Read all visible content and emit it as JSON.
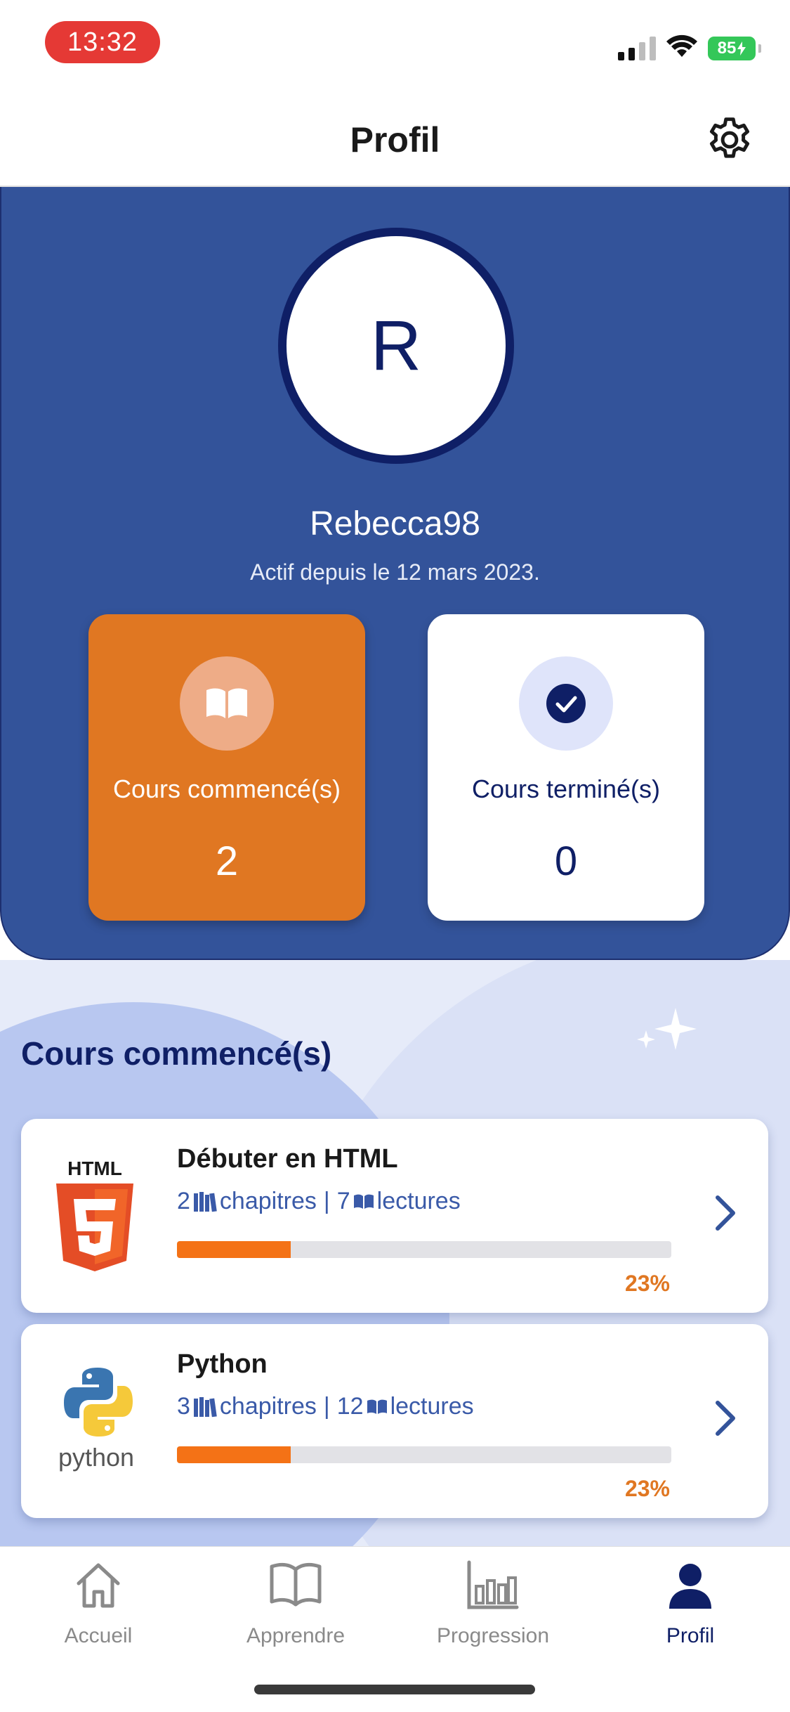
{
  "status_bar": {
    "time": "13:32",
    "battery": "85"
  },
  "header": {
    "title": "Profil"
  },
  "profile": {
    "avatar_initial": "R",
    "username": "Rebecca98",
    "active_since": "Actif depuis le 12 mars 2023."
  },
  "stats": {
    "started": {
      "label": "Cours commencé(s)",
      "value": "2"
    },
    "finished": {
      "label": "Cours terminé(s)",
      "value": "0"
    }
  },
  "courses_section": {
    "title": "Cours commencé(s)",
    "courses": [
      {
        "name": "Débuter en HTML",
        "chapters": "2",
        "chapters_label": "chapitres",
        "separator": "|",
        "lectures": "7",
        "lectures_label": "lectures",
        "progress": 23,
        "progress_label": "23%",
        "logo": "html5-logo",
        "logo_text": "HTML"
      },
      {
        "name": "Python",
        "chapters": "3",
        "chapters_label": "chapitres",
        "separator": "|",
        "lectures": "12",
        "lectures_label": "lectures",
        "progress": 23,
        "progress_label": "23%",
        "logo": "python-logo",
        "logo_text": "python"
      }
    ]
  },
  "tab_bar": {
    "tabs": [
      {
        "label": "Accueil",
        "icon": "home-icon",
        "active": false
      },
      {
        "label": "Apprendre",
        "icon": "book-icon",
        "active": false
      },
      {
        "label": "Progression",
        "icon": "bar-chart-icon",
        "active": false
      },
      {
        "label": "Profil",
        "icon": "person-icon",
        "active": true
      }
    ]
  },
  "colors": {
    "primary_blue": "#33539a",
    "navy": "#0f1f66",
    "accent_orange": "#e07722",
    "progress_orange": "#f47216"
  }
}
